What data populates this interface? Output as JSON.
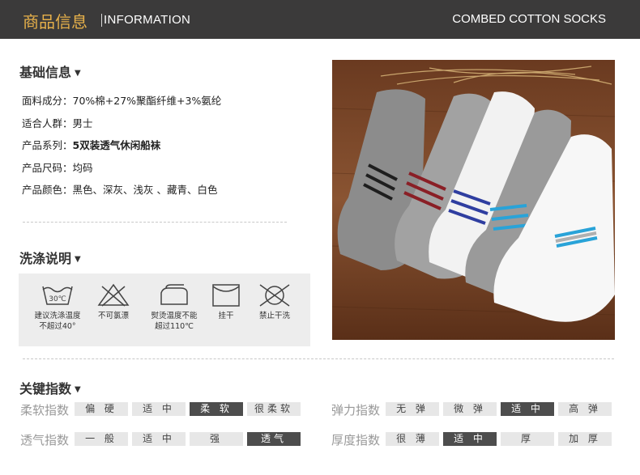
{
  "header": {
    "title_cn": "商品信息",
    "title_en": "INFORMATION",
    "right_text": "COMBED COTTON SOCKS"
  },
  "basic_info": {
    "title": "基础信息",
    "rows": [
      {
        "key": "面料成分：",
        "value": "70%棉+27%聚酯纤维+3%氨纶"
      },
      {
        "key": "适合人群：",
        "value": "男士"
      },
      {
        "key": "产品系列：",
        "value": "5双装透气休闲船袜"
      },
      {
        "key": "产品尺码：",
        "value": "均码"
      },
      {
        "key": "产品颜色：",
        "value": "黑色、深灰、浅灰 、藏青、白色"
      }
    ]
  },
  "washing": {
    "title": "洗涤说明",
    "temp_text": "30℃",
    "items": [
      {
        "icon": "wash-30-icon",
        "line1": "建议洗涤温度",
        "line2": "不超过40°"
      },
      {
        "icon": "no-bleach-icon",
        "line1": "不可氯漂",
        "line2": ""
      },
      {
        "icon": "iron-icon",
        "line1": "熨烫温度不能",
        "line2": "超过110℃"
      },
      {
        "icon": "hang-dry-icon",
        "line1": "挂干",
        "line2": ""
      },
      {
        "icon": "no-dry-clean-icon",
        "line1": "禁止干洗",
        "line2": ""
      }
    ]
  },
  "key_index": {
    "title": "关键指数",
    "groups": [
      {
        "label": "柔软指数",
        "options": [
          "偏 硬",
          "适 中",
          "柔 软",
          "很柔软"
        ],
        "selected": 2
      },
      {
        "label": "弹力指数",
        "options": [
          "无 弹",
          "微 弹",
          "适 中",
          "高 弹"
        ],
        "selected": 2
      },
      {
        "label": "透气指数",
        "options": [
          "一 般",
          "适 中",
          "强",
          "透气"
        ],
        "selected": 3
      },
      {
        "label": "厚度指数",
        "options": [
          "很 薄",
          "适 中",
          "厚",
          "加 厚"
        ],
        "selected": 1
      }
    ]
  },
  "colors": {
    "header_bg": "#3b3a3a",
    "header_accent": "#e6b04a",
    "selected_cell": "#4d4d4d",
    "cell": "#e7e7e7"
  }
}
